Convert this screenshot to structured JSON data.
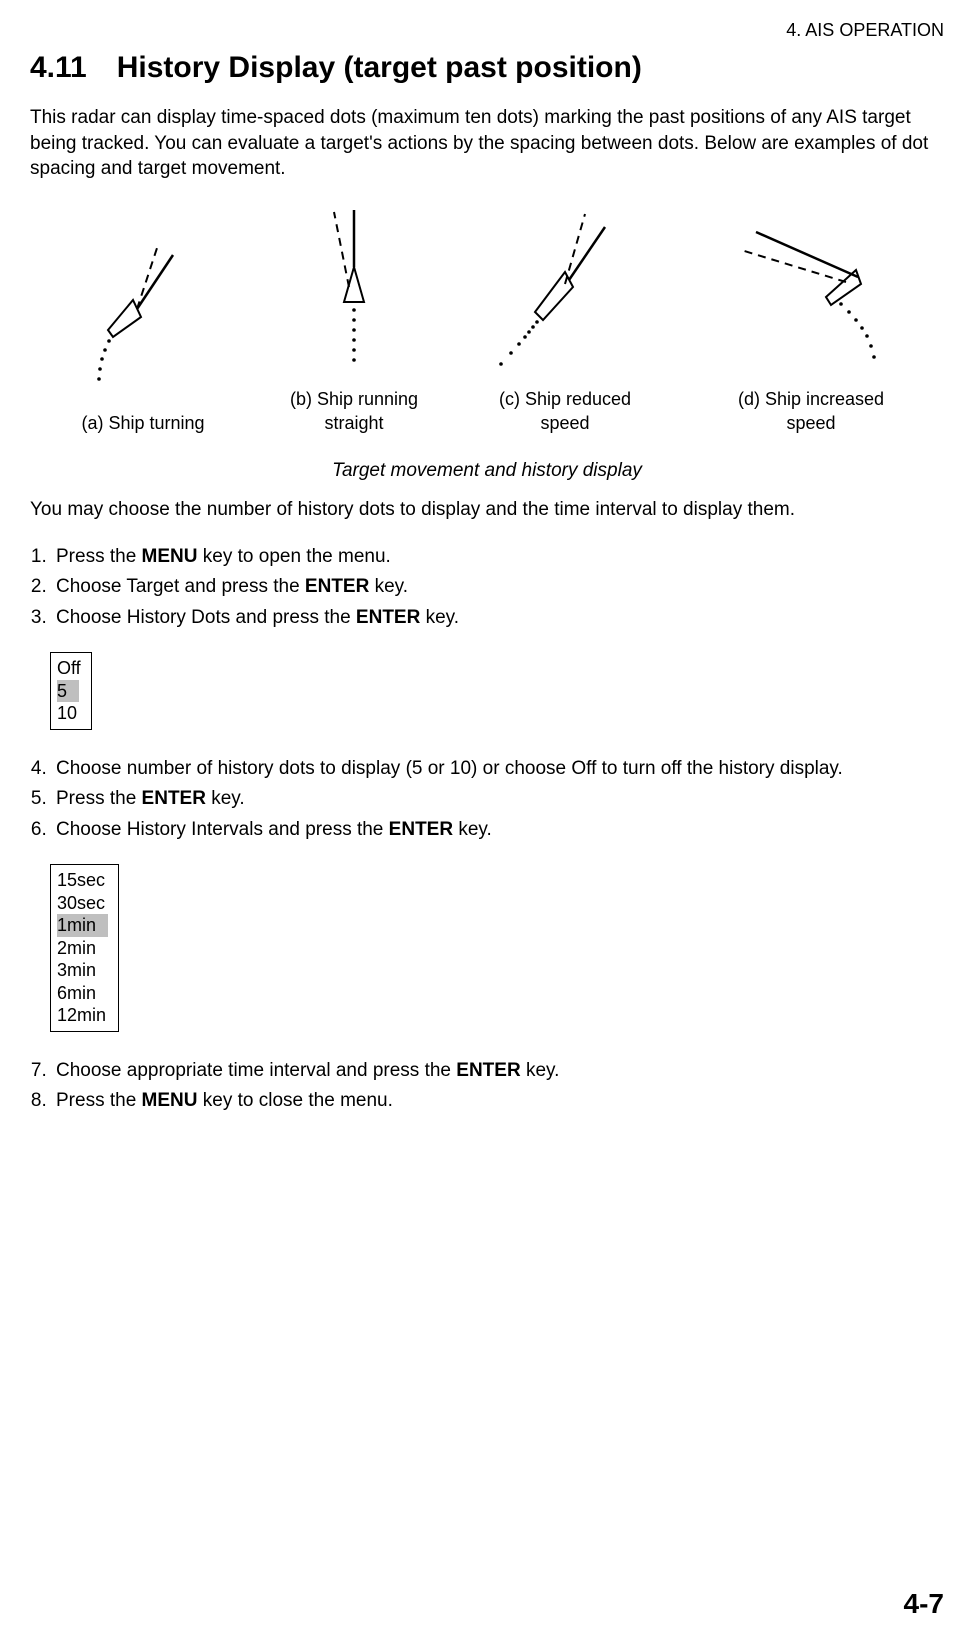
{
  "header": {
    "chapter": "4. AIS OPERATION"
  },
  "section": {
    "number": "4.11",
    "title": "History Display (target past position)"
  },
  "intro": "This radar can display time-spaced dots (maximum ten dots) marking the past positions of any AIS target being tracked. You can evaluate a target's actions by the spacing between dots. Below are examples of dot spacing and target movement.",
  "figures": {
    "a": "(a) Ship turning",
    "b1": "(b) Ship running",
    "b2": "straight",
    "c1": "(c) Ship reduced",
    "c2": "speed",
    "d1": "(d) Ship increased",
    "d2": "speed",
    "caption": "Target movement and history display"
  },
  "para2": "You may choose the number of history dots to display and the time interval to display them.",
  "steps1": {
    "s1a": "Press the ",
    "s1b": "MENU",
    "s1c": " key to open the menu.",
    "s2a": "Choose Target and press the ",
    "s2b": "ENTER",
    "s2c": " key.",
    "s3a": "Choose History Dots and press the ",
    "s3b": "ENTER",
    "s3c": " key."
  },
  "menu1": {
    "opt1": "Off",
    "opt2": "5",
    "opt3": "10"
  },
  "steps2": {
    "s4": "Choose number of history dots to display (5 or 10) or choose Off to turn off the history display.",
    "s5a": " Press the ",
    "s5b": "ENTER",
    "s5c": " key.",
    "s6a": "Choose History Intervals and press the ",
    "s6b": "ENTER",
    "s6c": " key."
  },
  "menu2": {
    "opt1": "15sec",
    "opt2": "30sec",
    "opt3": "1min",
    "opt4": "2min",
    "opt5": "3min",
    "opt6": "6min",
    "opt7": "12min"
  },
  "steps3": {
    "s7a": " Choose appropriate time interval and press the ",
    "s7b": "ENTER",
    "s7c": " key.",
    "s8a": "Press the ",
    "s8b": "MENU",
    "s8c": " key to close the menu."
  },
  "footer": {
    "page": "4-7"
  }
}
